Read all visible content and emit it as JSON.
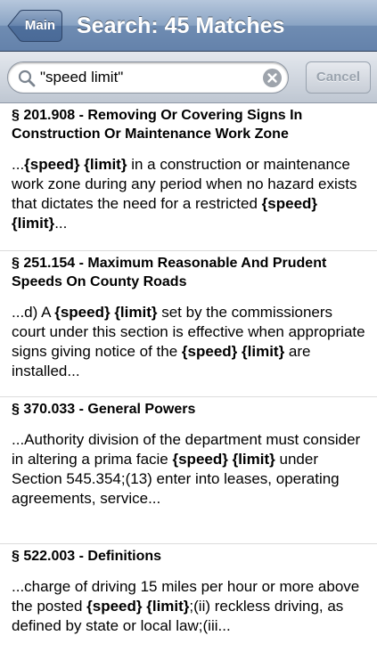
{
  "navbar": {
    "back_label": "Main",
    "title": "Search: 45 Matches"
  },
  "search": {
    "query": "\"speed limit\"",
    "cancel_label": "Cancel"
  },
  "results": [
    {
      "title": "§ 201.908 - Removing Or Covering Signs In Construction Or Maintenance Work Zone",
      "snippet": [
        {
          "t": "...",
          "b": false
        },
        {
          "t": "{speed}",
          "b": true
        },
        {
          "t": " ",
          "b": false
        },
        {
          "t": "{limit}",
          "b": true
        },
        {
          "t": " in a construction or maintenance work zone during any period when no hazard exists that dictates the need for a restricted ",
          "b": false
        },
        {
          "t": "{speed}",
          "b": true
        },
        {
          "t": " ",
          "b": false
        },
        {
          "t": "{limit}",
          "b": true
        },
        {
          "t": "...",
          "b": false
        }
      ]
    },
    {
      "title": "§ 251.154 - Maximum Reasonable And Prudent Speeds On County Roads",
      "snippet": [
        {
          "t": "...d) A ",
          "b": false
        },
        {
          "t": "{speed}",
          "b": true
        },
        {
          "t": " ",
          "b": false
        },
        {
          "t": "{limit}",
          "b": true
        },
        {
          "t": " set by the commissioners court under this section is effective when appropriate signs giving notice of the ",
          "b": false
        },
        {
          "t": "{speed}",
          "b": true
        },
        {
          "t": " ",
          "b": false
        },
        {
          "t": "{limit}",
          "b": true
        },
        {
          "t": " are installed...",
          "b": false
        }
      ]
    },
    {
      "title": "§ 370.033 - General Powers",
      "snippet": [
        {
          "t": "...Authority division of the department must consider in altering a prima facie ",
          "b": false
        },
        {
          "t": "{speed}",
          "b": true
        },
        {
          "t": " ",
          "b": false
        },
        {
          "t": "{limit}",
          "b": true
        },
        {
          "t": " under Section 545.354;(13) enter into leases, operating agreements, service...",
          "b": false
        }
      ]
    },
    {
      "title": "§ 522.003 - Definitions",
      "snippet": [
        {
          "t": "...charge of driving 15 miles per hour or more above the posted ",
          "b": false
        },
        {
          "t": "{speed}",
          "b": true
        },
        {
          "t": " ",
          "b": false
        },
        {
          "t": "{limit}",
          "b": true
        },
        {
          "t": ";(ii) reckless driving, as defined by state or local law;(iii...",
          "b": false
        }
      ]
    }
  ]
}
